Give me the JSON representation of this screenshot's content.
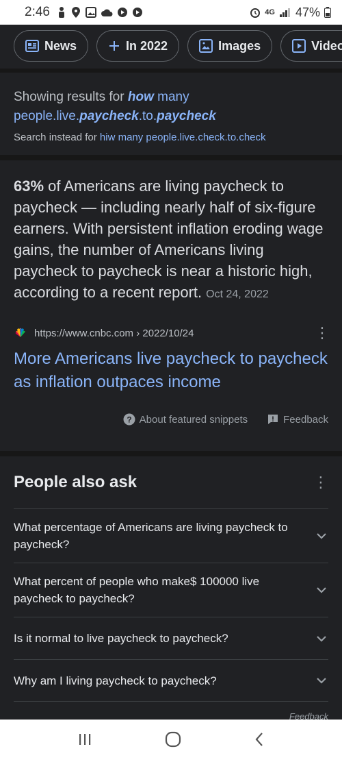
{
  "status": {
    "time": "2:46",
    "network": "4G",
    "battery": "47%"
  },
  "chips": [
    {
      "label": "News",
      "icon": "news-icon"
    },
    {
      "label": "In 2022",
      "icon": "plus-icon"
    },
    {
      "label": "Images",
      "icon": "image-icon"
    },
    {
      "label": "Videos",
      "icon": "video-icon"
    }
  ],
  "spelling": {
    "prefix": "Showing results for ",
    "corrected": [
      "how",
      " many people.live.",
      "paycheck",
      ".to.",
      "paycheck"
    ],
    "instead_prefix": "Search instead for ",
    "original_query": "hiw many people.live.check.to.check"
  },
  "snippet": {
    "highlight": "63%",
    "text": " of Americans are living paycheck to paycheck — including nearly half of six-figure earners. With persistent inflation eroding wage gains, the number of Americans living paycheck to paycheck is near a historic high, according to a recent report.",
    "date": "Oct 24, 2022",
    "source_url": "https://www.cnbc.com › 2022/10/24",
    "title": "More Americans live paycheck to paycheck as inflation outpaces income",
    "about_label": "About featured snippets",
    "feedback_label": "Feedback"
  },
  "paa": {
    "heading": "People also ask",
    "questions": [
      "What percentage of Americans are living paycheck to paycheck?",
      "What percent of people who make$ 100000 live paycheck to paycheck?",
      "Is it normal to live paycheck to paycheck?",
      "Why am I living paycheck to paycheck?"
    ],
    "feedback_label": "Feedback"
  },
  "colors": {
    "background": "#202124",
    "link": "#8ab4f8",
    "text": "#e8eaed",
    "muted": "#9aa0a6"
  }
}
